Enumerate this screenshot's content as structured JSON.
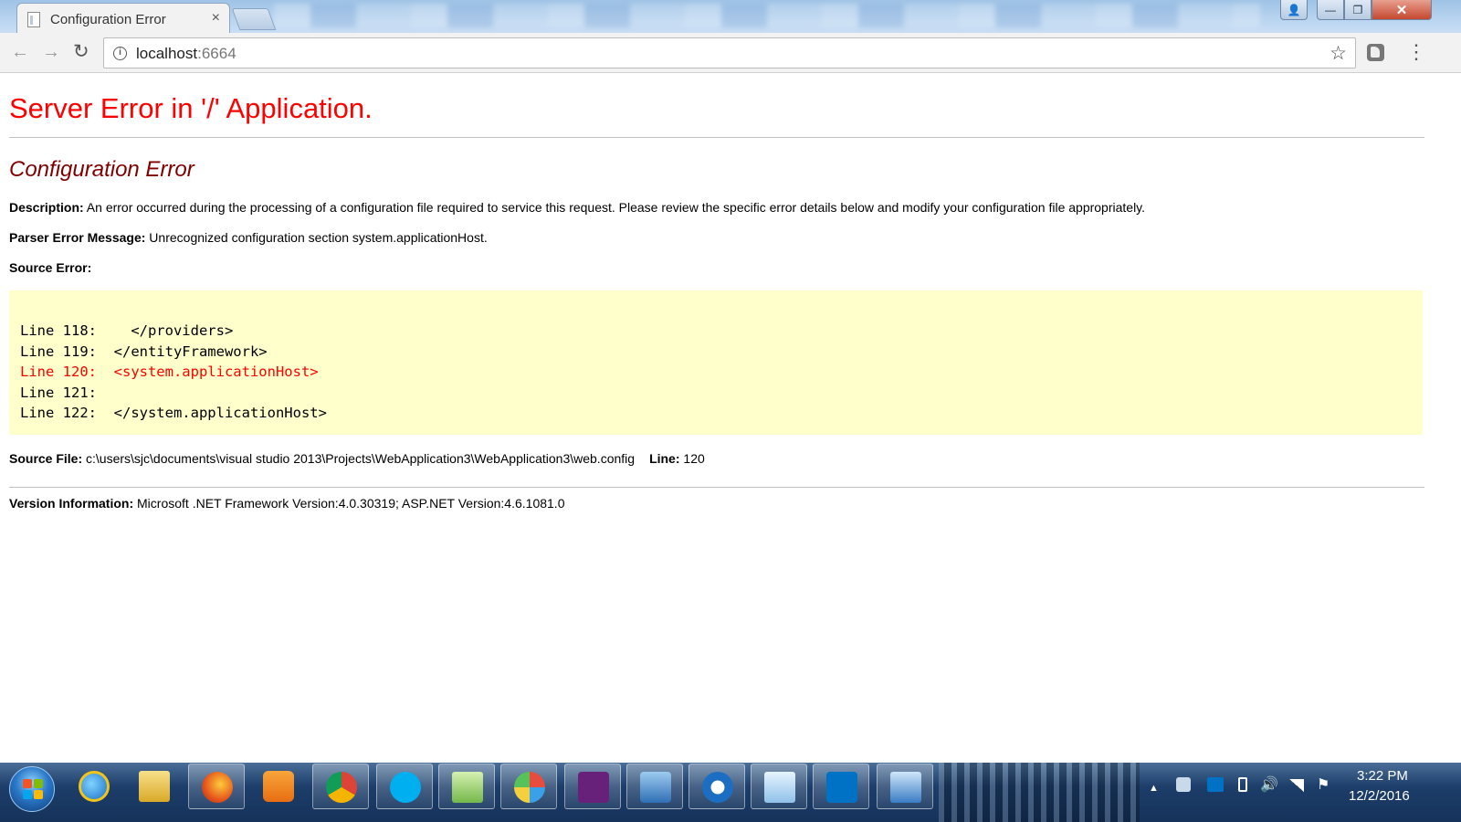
{
  "browser": {
    "tab_title": "Configuration Error",
    "tab_close": "×",
    "url_host": "localhost",
    "url_port": ":6664",
    "nav": {
      "back": "←",
      "forward": "→",
      "reload": "↻",
      "star": "☆",
      "menu": "⋮",
      "info": "i"
    },
    "window_controls": {
      "minimize": "—",
      "maximize": "❐",
      "close": "✕",
      "profile": "👤"
    }
  },
  "page": {
    "heading": "Server Error in '/' Application.",
    "subheading": "Configuration Error",
    "description_label": "Description:",
    "description_text": " An error occurred during the processing of a configuration file required to service this request. Please review the specific error details below and modify your configuration file appropriately.",
    "parser_label": "Parser Error Message:",
    "parser_text": " Unrecognized configuration section system.applicationHost.",
    "source_error_label": "Source Error:",
    "source_lines": [
      {
        "text": "Line 118:    </providers>",
        "error": false
      },
      {
        "text": "Line 119:  </entityFramework>",
        "error": false
      },
      {
        "text": "Line 120:  <system.applicationHost>",
        "error": true
      },
      {
        "text": "Line 121:",
        "error": false
      },
      {
        "text": "Line 122:  </system.applicationHost>",
        "error": false
      }
    ],
    "source_file_label": "Source File:",
    "source_file_path": " c:\\users\\sjc\\documents\\visual studio 2013\\Projects\\WebApplication3\\WebApplication3\\web.config",
    "line_label": "Line:",
    "line_value": " 120",
    "version_label": "Version Information:",
    "version_text": " Microsoft .NET Framework Version:4.0.30319; ASP.NET Version:4.6.1081.0"
  },
  "colors": {
    "heading": "#ff0000",
    "subheading": "#800000",
    "code_background": "#ffffcc",
    "error_line": "#ff0000"
  },
  "taskbar": {
    "apps": [
      "internet-explorer-icon",
      "file-explorer-icon",
      "firefox-icon",
      "media-player-icon",
      "chrome-icon",
      "skype-icon",
      "notepad-plus-icon",
      "paint-icon",
      "visual-studio-icon",
      "network-shield-icon",
      "chat-icon",
      "notepad-icon",
      "outlook-icon",
      "remote-desktop-icon"
    ],
    "tray": {
      "show_hidden": "▲",
      "volume": "🔊",
      "flag": "⚑"
    },
    "clock_time": "3:22 PM",
    "clock_date": "12/2/2016"
  }
}
